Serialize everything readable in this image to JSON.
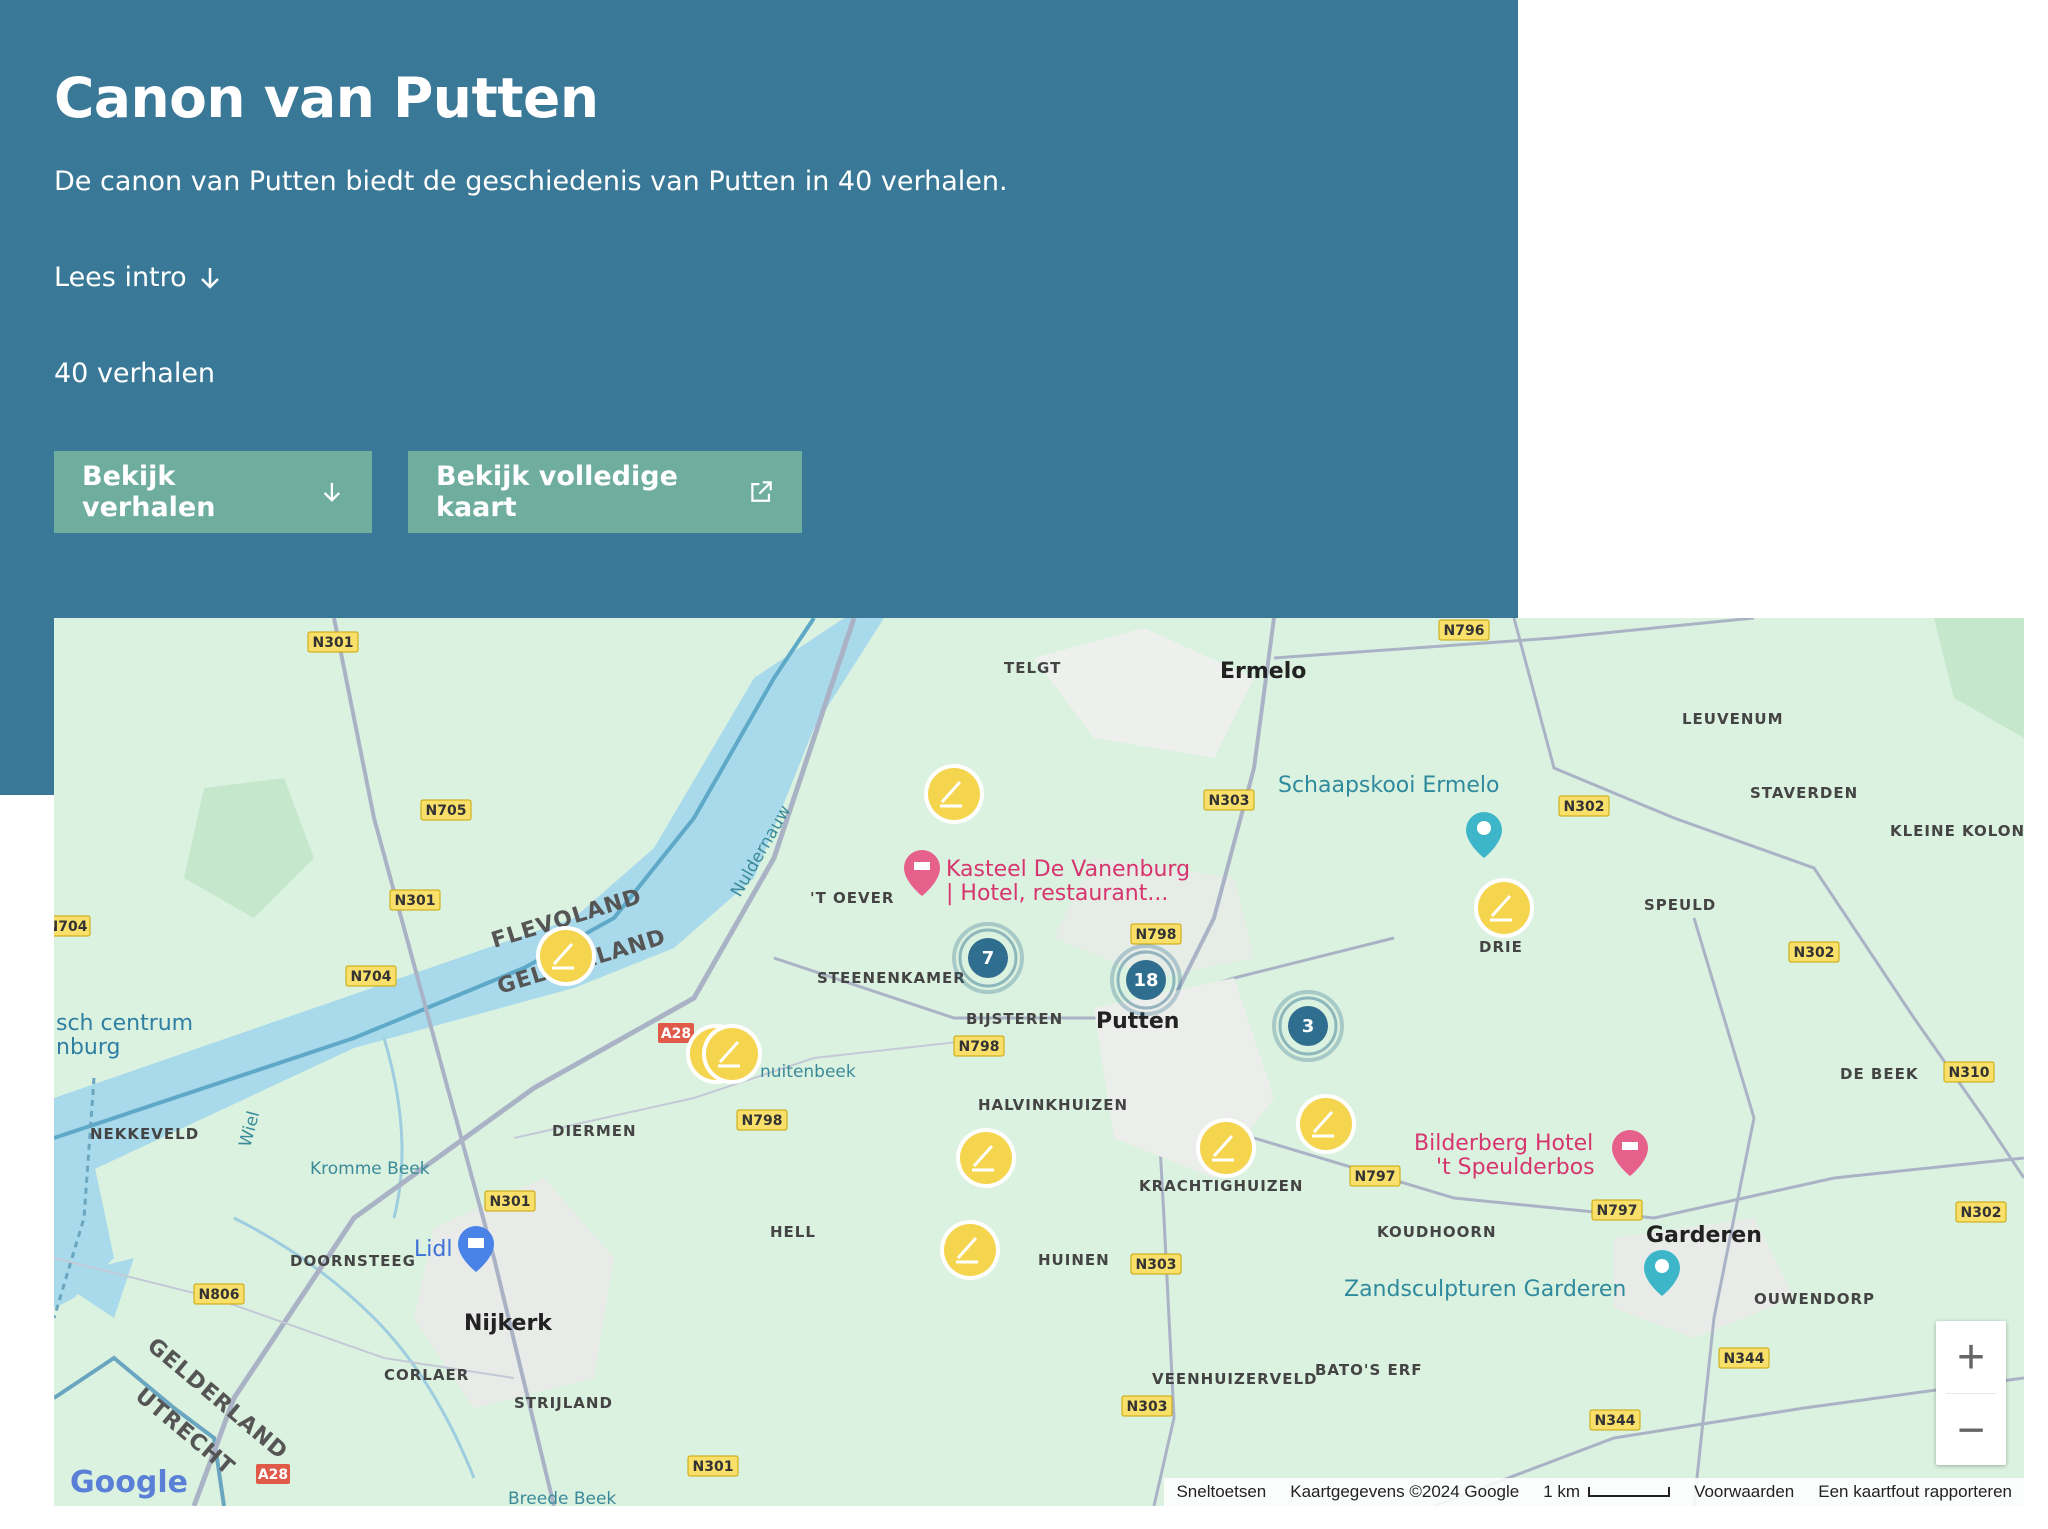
{
  "hero": {
    "title": "Canon van Putten",
    "description": "De canon van Putten biedt de geschiedenis van Putten in 40 verhalen.",
    "intro_link": "Lees intro",
    "count": "40 verhalen",
    "buttons": {
      "stories": "Bekijk verhalen",
      "full_map": "Bekijk volledige kaart"
    },
    "colors": {
      "background": "#397896",
      "button": "#6fae9e"
    }
  },
  "map": {
    "places": {
      "ermelo": "Ermelo",
      "putten": "Putten",
      "nijkerk": "Nijkerk",
      "garderen": "Garderen",
      "telgt": "TELGT",
      "leuvenum": "LEUVENUM",
      "staverden": "STAVERDEN",
      "kleine_kolon": "KLEINE KOLON",
      "speuld": "SPEULD",
      "drie": "DRIE",
      "t_oever": "'T OEVER",
      "steenenkamer": "STEENENKAMER",
      "bijsteren": "BIJSTEREN",
      "halvinkhuizen": "HALVINKHUIZEN",
      "krachtighuizen": "KRACHTIGHUIZEN",
      "koudhoorn": "KOUDHOORN",
      "diermen": "DIERMEN",
      "hell": "HELL",
      "huinen": "HUINEN",
      "doornsteeg": "DOORNSTEEG",
      "corlaer": "CORLAER",
      "strijland": "STRIJLAND",
      "veenhuizerveld": "VEENHUIZERVELD",
      "batos_erf": "BATO'S ERF",
      "ouwendorp": "OUWENDORP",
      "de_beek": "DE BEEK",
      "nekkeveld": "NEKKEVELD",
      "flevoland": "FLEVOLAND",
      "gelderland": "GELDERLAND",
      "gelderland_sw": "GELDERLAND",
      "utrecht": "UTRECHT",
      "nuldernauw": "Nuldernauw",
      "kromme_beek": "Kromme Beek",
      "breede_beek": "Breede Beek",
      "wiel": "Wiel",
      "sch_centrum": "sch centrum",
      "nburg": "nburg",
      "muitenbeek": "nuitenbeek"
    },
    "pois": {
      "schaapskooi": "Schaapskooi Ermelo",
      "vanenburg_1": "Kasteel De Vanenburg",
      "vanenburg_2": "| Hotel, restaurant...",
      "bilderberg_1": "Bilderberg Hotel",
      "bilderberg_2": "'t Speulderbos",
      "zandsculpturen": "Zandsculpturen Garderen",
      "lidl": "Lidl"
    },
    "roads": [
      "N301",
      "N705",
      "N301",
      "N704",
      "N704",
      "A28",
      "N798",
      "N301",
      "N806",
      "N796",
      "N303",
      "N302",
      "N798",
      "N798",
      "N302",
      "N310",
      "N797",
      "N797",
      "N302",
      "N303",
      "N344",
      "N344",
      "N303",
      "N301",
      "A28"
    ],
    "clusters": {
      "c1": "7",
      "c2": "18",
      "c3": "3"
    },
    "zoom": {
      "plus": "+",
      "minus": "−"
    },
    "footer": {
      "shortcuts": "Sneltoetsen",
      "mapdata": "Kaartgegevens ©2024 Google",
      "scale": "1 km",
      "terms": "Voorwaarden",
      "report": "Een kaartfout rapporteren"
    },
    "google": "Google"
  }
}
